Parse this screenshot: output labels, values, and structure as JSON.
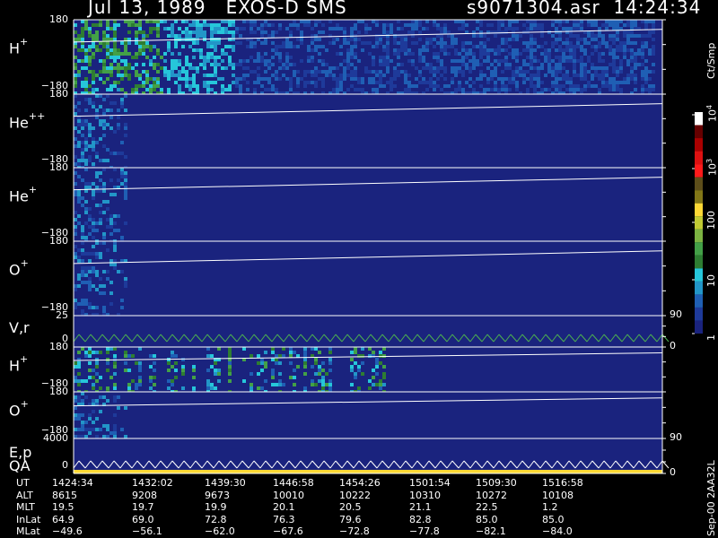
{
  "header": {
    "title": "Jul 13, 1989   EXOS-D SMS",
    "fileinfo": "s9071304.asr  14:24:34"
  },
  "panels": [
    {
      "id": "h1",
      "label": "H",
      "sup": "+",
      "ytop": "180",
      "ybot": "−180",
      "style": "spectrogram"
    },
    {
      "id": "he2",
      "label": "He",
      "sup": "++",
      "ytop": "180",
      "ybot": "−180",
      "style": "quiet"
    },
    {
      "id": "he1",
      "label": "He",
      "sup": "+",
      "ytop": "180",
      "ybot": "−180",
      "style": "quiet"
    },
    {
      "id": "o1",
      "label": "O",
      "sup": "+",
      "ytop": "180",
      "ybot": "−180",
      "style": "quiet",
      "right_tick": "90"
    },
    {
      "id": "vr",
      "label": "V,r",
      "sup": "",
      "ytop": "25",
      "ybot": "0",
      "style": "line",
      "right_tick": "0"
    },
    {
      "id": "h2",
      "label": "H",
      "sup": "+",
      "ytop": "180",
      "ybot": "−180",
      "style": "bursts"
    },
    {
      "id": "o2",
      "label": "O",
      "sup": "+",
      "ytop": "180",
      "ybot": "−180",
      "style": "quiet",
      "right_tick": "90"
    },
    {
      "id": "ep",
      "label": "E,p",
      "sub_label": "QA",
      "ytop": "4000",
      "ybot": "0",
      "style": "line",
      "right_tick": "0"
    }
  ],
  "colorbar": {
    "title": "Ct/Smp",
    "tick_labels": [
      "1",
      "10",
      "100",
      "10",
      "10"
    ],
    "tick_exps": [
      "",
      "",
      "",
      "3",
      "4"
    ],
    "colors": [
      "#1a237e",
      "#1e3a9a",
      "#1f5fb4",
      "#2296c8",
      "#26c6da",
      "#2e7d32",
      "#43a047",
      "#7cb342",
      "#c0ca33",
      "#fdd835",
      "#827717",
      "#5d4e1a",
      "#ff1a1a",
      "#d11",
      "#a00",
      "#600",
      "#ffffff"
    ]
  },
  "orbit_table": {
    "labels": [
      "UT",
      "ALT",
      "MLT",
      "InLat",
      "MLat"
    ],
    "rows": [
      [
        "1424:34",
        "1432:02",
        "1439:30",
        "1446:58",
        "1454:26",
        "1501:54",
        "1509:30",
        "1516:58"
      ],
      [
        "8615",
        "9208",
        "9673",
        "10010",
        "10222",
        "10310",
        "10272",
        "10108"
      ],
      [
        "19.5",
        "19.7",
        "19.9",
        "20.1",
        "20.5",
        "21.1",
        "22.5",
        "1.2"
      ],
      [
        "64.9",
        "69.0",
        "72.8",
        "76.3",
        "79.6",
        "82.8",
        "85.0",
        "85.0"
      ],
      [
        "−49.6",
        "−56.1",
        "−62.0",
        "−67.6",
        "−72.8",
        "−77.8",
        "−82.1",
        "−84.0"
      ]
    ]
  },
  "footer_note": "Sep-00  2AA32L",
  "chart_data": {
    "type": "heatmap",
    "title": "Jul 13, 1989   EXOS-D SMS",
    "x_ticks": [
      "1424:34",
      "1432:02",
      "1439:30",
      "1446:58",
      "1454:26",
      "1501:54",
      "1509:30",
      "1516:58"
    ],
    "series": [
      {
        "name": "H+",
        "ylim": [
          -180,
          180
        ]
      },
      {
        "name": "He++",
        "ylim": [
          -180,
          180
        ]
      },
      {
        "name": "He+",
        "ylim": [
          -180,
          180
        ]
      },
      {
        "name": "O+",
        "ylim": [
          -180,
          180
        ]
      },
      {
        "name": "V,r",
        "ylim": [
          0,
          25
        ]
      },
      {
        "name": "H+",
        "ylim": [
          -180,
          180
        ]
      },
      {
        "name": "O+",
        "ylim": [
          -180,
          180
        ]
      },
      {
        "name": "E,p",
        "ylim": [
          0,
          4000
        ]
      }
    ],
    "colorbar_label": "Ct/Smp",
    "colorbar_scale": "log",
    "colorbar_range": [
      1,
      10000
    ]
  }
}
